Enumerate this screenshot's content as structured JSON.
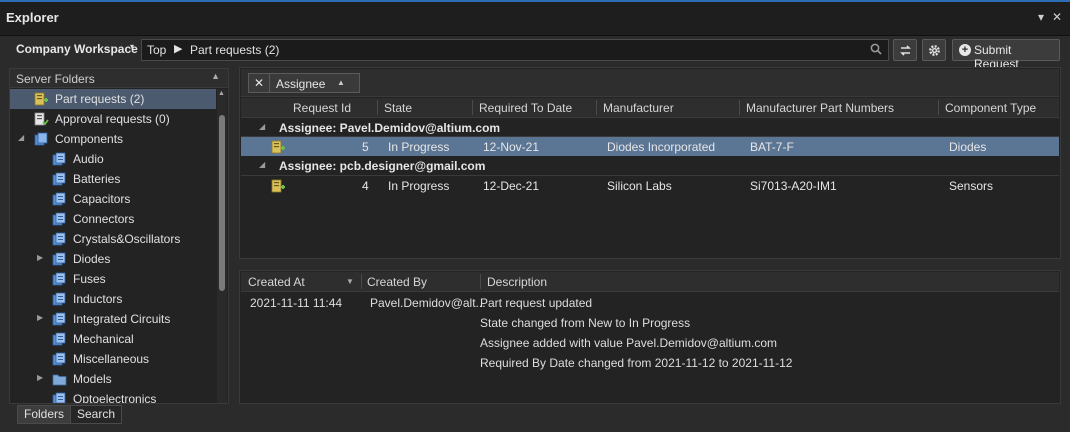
{
  "window": {
    "title": "Explorer",
    "dropdown_glyph": "▾",
    "pin_glyph": "▾",
    "close_glyph": "✕"
  },
  "toolbar": {
    "workspace": "Company Workspace",
    "path": [
      "Top",
      "Part requests (2)"
    ],
    "submit_label": "Submit Request"
  },
  "left": {
    "header": "Server Folders",
    "items": [
      {
        "label": "Part requests (2)",
        "icon": "part-request-icon",
        "level": 1,
        "expander": "",
        "selected": true
      },
      {
        "label": "Approval requests (0)",
        "icon": "approval-request-icon",
        "level": 1,
        "expander": ""
      },
      {
        "label": "Components",
        "icon": "components-folder-icon",
        "level": 1,
        "expander": "◢"
      },
      {
        "label": "Audio",
        "icon": "component-folder-icon",
        "level": 2,
        "expander": ""
      },
      {
        "label": "Batteries",
        "icon": "component-folder-icon",
        "level": 2,
        "expander": ""
      },
      {
        "label": "Capacitors",
        "icon": "component-folder-icon",
        "level": 2,
        "expander": ""
      },
      {
        "label": "Connectors",
        "icon": "component-folder-icon",
        "level": 2,
        "expander": ""
      },
      {
        "label": "Crystals&Oscillators",
        "icon": "component-folder-icon",
        "level": 2,
        "expander": ""
      },
      {
        "label": "Diodes",
        "icon": "component-folder-icon",
        "level": 2,
        "expander": "▶"
      },
      {
        "label": "Fuses",
        "icon": "component-folder-icon",
        "level": 2,
        "expander": ""
      },
      {
        "label": "Inductors",
        "icon": "component-folder-icon",
        "level": 2,
        "expander": ""
      },
      {
        "label": "Integrated Circuits",
        "icon": "component-folder-icon",
        "level": 2,
        "expander": "▶"
      },
      {
        "label": "Mechanical",
        "icon": "component-folder-icon",
        "level": 2,
        "expander": ""
      },
      {
        "label": "Miscellaneous",
        "icon": "component-folder-icon",
        "level": 2,
        "expander": ""
      },
      {
        "label": "Models",
        "icon": "models-folder-icon",
        "level": 2,
        "expander": "▶"
      },
      {
        "label": "Optoelectronics",
        "icon": "component-folder-icon",
        "level": 2,
        "expander": ""
      }
    ],
    "tabs": [
      "Folders",
      "Search"
    ]
  },
  "grid": {
    "group_chip": "Assignee",
    "columns": [
      "Request Id",
      "State",
      "Required To Date",
      "Manufacturer",
      "Manufacturer Part Numbers",
      "Component Type"
    ],
    "groups": [
      {
        "label": "Assignee: Pavel.Demidov@altium.com",
        "rows": [
          {
            "id": "5",
            "state": "In Progress",
            "date": "12-Nov-21",
            "manufacturer": "Diodes Incorporated",
            "mpn": "BAT-7-F",
            "type": "Diodes",
            "selected": true
          }
        ]
      },
      {
        "label": "Assignee: pcb.designer@gmail.com",
        "rows": [
          {
            "id": "4",
            "state": "In Progress",
            "date": "12-Dec-21",
            "manufacturer": "Silicon Labs",
            "mpn": "Si7013-A20-IM1",
            "type": "Sensors"
          }
        ]
      }
    ]
  },
  "detail": {
    "columns": [
      "Created At",
      "Created By",
      "Description"
    ],
    "created_at": "2021-11-11 11:44",
    "created_by": "Pavel.Demidov@alt...",
    "lines": [
      "Part request updated",
      "State changed from New to In Progress",
      "Assignee added with value Pavel.Demidov@altium.com",
      "Required By Date changed from 2021-11-12 to 2021-11-12"
    ]
  },
  "colors": {
    "accent": "#2d6db5",
    "selection": "#5b7594",
    "tree_selection": "#4b5a6e"
  }
}
